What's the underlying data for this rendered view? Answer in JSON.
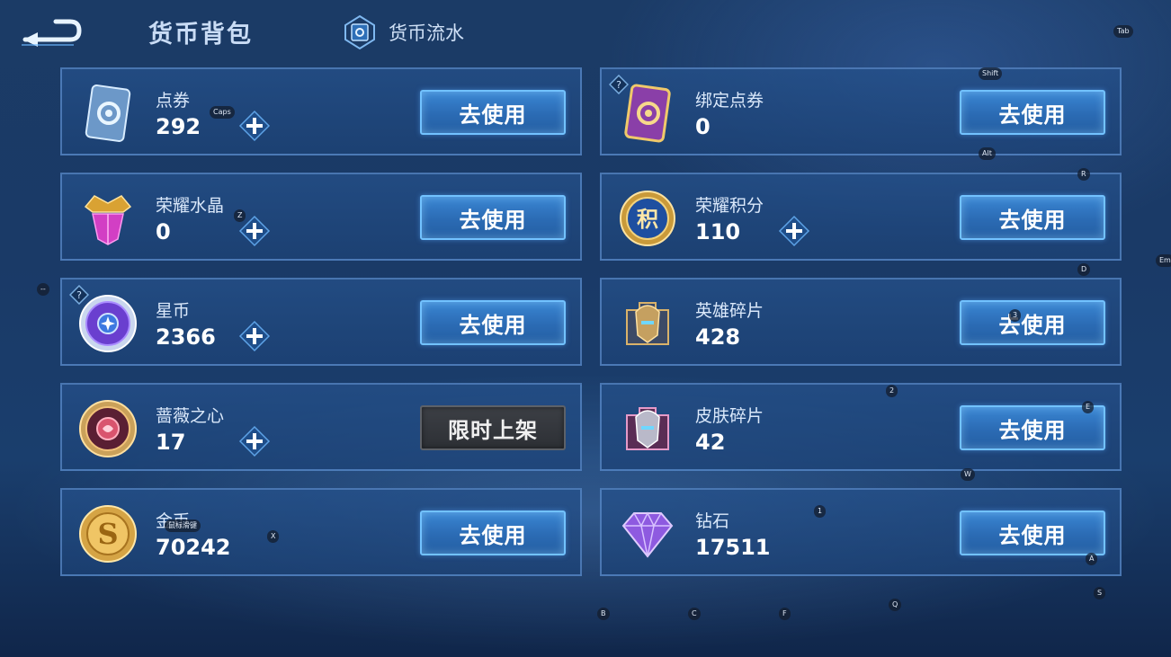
{
  "header": {
    "title": "货币背包",
    "ledger_label": "货币流水"
  },
  "action_label": "去使用",
  "limited_label": "限时上架",
  "currencies": [
    {
      "name": "点券",
      "amount": "292",
      "icon": "voucher-card-icon"
    },
    {
      "name": "绑定点券",
      "amount": "0",
      "icon": "bound-voucher-card-icon"
    },
    {
      "name": "荣耀水晶",
      "amount": "0",
      "icon": "glory-crystal-icon"
    },
    {
      "name": "荣耀积分",
      "amount": "110",
      "icon": "glory-points-icon"
    },
    {
      "name": "星币",
      "amount": "2366",
      "icon": "star-coin-icon"
    },
    {
      "name": "英雄碎片",
      "amount": "428",
      "icon": "hero-fragment-icon"
    },
    {
      "name": "蔷薇之心",
      "amount": "17",
      "icon": "rose-heart-icon"
    },
    {
      "name": "皮肤碎片",
      "amount": "42",
      "icon": "skin-fragment-icon"
    },
    {
      "name": "金币",
      "amount": "70242",
      "icon": "gold-coin-icon"
    },
    {
      "name": "钻石",
      "amount": "17511",
      "icon": "diamond-icon"
    }
  ],
  "key_hints": [
    "Tab",
    "Shift",
    "Caps",
    "Alt",
    "R",
    "Z",
    "D",
    "Em",
    "--",
    "3",
    "2",
    "E",
    "W",
    "1",
    "X",
    "A",
    "S",
    "Q",
    "B",
    "C",
    "F",
    "鼠标滑键"
  ],
  "colors": {
    "accent": "#72c2ff",
    "button": "#2b6bb4",
    "background": "#1a3a67"
  }
}
